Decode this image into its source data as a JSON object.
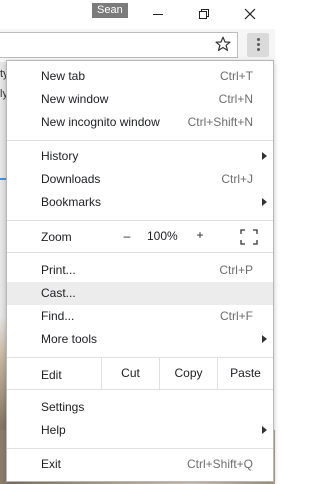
{
  "window": {
    "profile_name": "Sean"
  },
  "address_bar": {
    "value": ""
  },
  "page_fragments": {
    "line1": "ty",
    "line2": "ly"
  },
  "menu": {
    "new_tab": {
      "label": "New tab",
      "shortcut": "Ctrl+T"
    },
    "new_window": {
      "label": "New window",
      "shortcut": "Ctrl+N"
    },
    "new_incognito": {
      "label": "New incognito window",
      "shortcut": "Ctrl+Shift+N"
    },
    "history": {
      "label": "History"
    },
    "downloads": {
      "label": "Downloads",
      "shortcut": "Ctrl+J"
    },
    "bookmarks": {
      "label": "Bookmarks"
    },
    "zoom": {
      "label": "Zoom",
      "minus": "–",
      "value": "100%",
      "plus": "+"
    },
    "print": {
      "label": "Print...",
      "shortcut": "Ctrl+P"
    },
    "cast": {
      "label": "Cast..."
    },
    "find": {
      "label": "Find...",
      "shortcut": "Ctrl+F"
    },
    "more_tools": {
      "label": "More tools"
    },
    "edit": {
      "label": "Edit",
      "cut": "Cut",
      "copy": "Copy",
      "paste": "Paste"
    },
    "settings": {
      "label": "Settings"
    },
    "help": {
      "label": "Help"
    },
    "exit": {
      "label": "Exit",
      "shortcut": "Ctrl+Shift+Q"
    }
  },
  "icons": [
    "minimize-icon",
    "maximize-icon",
    "close-icon",
    "bookmark-star-icon",
    "menu-kebab-icon",
    "fullscreen-icon",
    "submenu-arrow-icon"
  ]
}
